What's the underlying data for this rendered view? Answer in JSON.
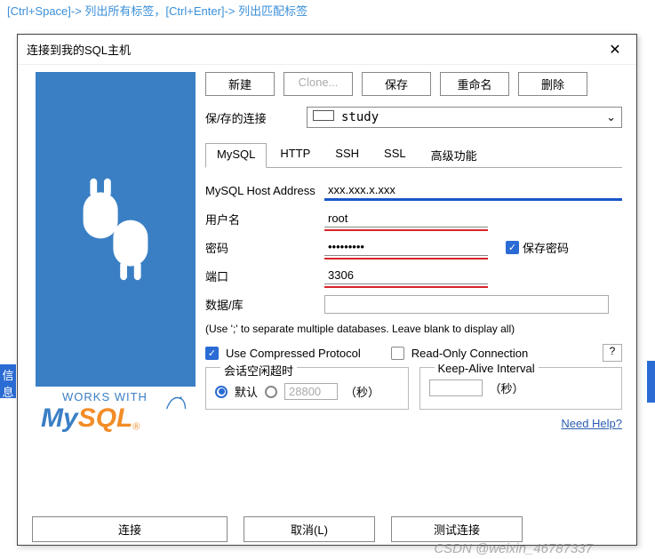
{
  "top_hint": "[Ctrl+Space]-> 列出所有标签，[Ctrl+Enter]-> 列出匹配标签",
  "dialog": {
    "title": "连接到我的SQL主机"
  },
  "toolbar": {
    "new": "新建",
    "clone": "Clone...",
    "save": "保存",
    "rename": "重命名",
    "delete": "删除"
  },
  "saved_conn": {
    "label": "保/存的连接",
    "value": "study"
  },
  "tabs": {
    "mysql": "MySQL",
    "http": "HTTP",
    "ssh": "SSH",
    "ssl": "SSL",
    "advanced": "高级功能"
  },
  "form": {
    "host_label": "MySQL Host Address",
    "host_value": "xxx.xxx.x.xxx",
    "user_label": "用户名",
    "user_value": "root",
    "pwd_label": "密码",
    "pwd_value": "•••••••••",
    "save_pwd": "保存密码",
    "port_label": "端口",
    "port_value": "3306",
    "db_label": "数据/库",
    "db_value": "",
    "db_hint": "(Use ';' to separate multiple databases. Leave blank to display all)",
    "compressed": "Use Compressed Protocol",
    "readonly": "Read-Only Connection",
    "help_q": "?",
    "idle_legend": "会话空闲超时",
    "default": "默认",
    "idle_val": "28800",
    "seconds": "（秒）",
    "keepalive_legend": "Keep-Alive Interval",
    "need_help": "Need Help?"
  },
  "footer": {
    "connect": "连接",
    "cancel": "取消(L)",
    "test": "测试连接"
  },
  "blue_bar": "信息",
  "watermark": "CSDN @weixin_46787337"
}
